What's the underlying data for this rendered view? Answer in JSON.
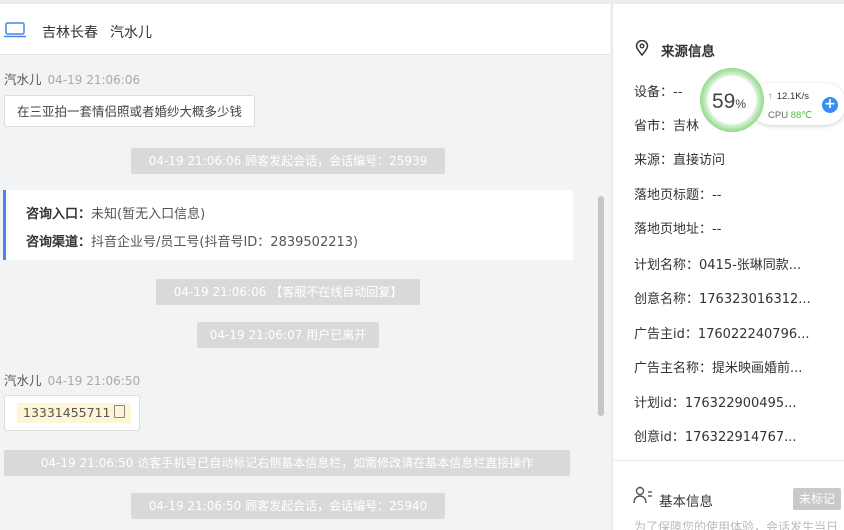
{
  "header": {
    "location": "吉林长春",
    "customer_name": "汽水儿"
  },
  "messages": {
    "msg1": {
      "sender": "汽水儿",
      "time": "04-19 21:06:06",
      "text": "在三亚拍一套情侣照或者婚纱大概多少钱"
    },
    "sys1": "04-19 21:06:06 顾客发起会话，会话编号：25939",
    "consult": {
      "entry_label": "咨询入口：",
      "entry_value": "未知(暂无入口信息)",
      "channel_label": "咨询渠道：",
      "channel_value": "抖音企业号/员工号(抖音号ID：2839502213)"
    },
    "sys2": "04-19 21:06:06 【客服不在线自动回复】",
    "sys3": "04-19 21:06:07 用户已离开",
    "msg2": {
      "sender": "汽水儿",
      "time": "04-19 21:06:50",
      "phone": "13331455711"
    },
    "sys4": "04-19 21:06:50 访客手机号已自动标记右侧基本信息栏，如需修改请在基本信息栏直接操作",
    "sys5": "04-19 21:06:50 顾客发起会话，会话编号：25940"
  },
  "source_panel": {
    "title": "来源信息",
    "rows": [
      "设备：--",
      "省市：吉林",
      "来源：直接访问",
      "落地页标题：--",
      "落地页地址：--",
      "计划名称：0415-张琳同款...",
      "创意名称：176323016312...",
      "广告主id：176022240796...",
      "广告主名称：提米映画婚前...",
      "计划id：176322900495...",
      "创意id：176322914767..."
    ],
    "basic_title": "基本信息",
    "tag": "未标记",
    "privacy_note": "为了保障您的使用体验，会话发生当日"
  },
  "monitor": {
    "percent": "59",
    "percent_unit": "%",
    "net_speed": "12.1K/s",
    "cpu_label": "CPU",
    "cpu_temp": "88℃"
  },
  "colors": {
    "accent": "#4a86e8",
    "system_msg_bg": "#d9d9d9",
    "phone_highlight": "#fdf5d6",
    "monitor_green": "#6fcd6a"
  },
  "icons": [
    "laptop-icon",
    "copy-icon",
    "location-pin-icon",
    "user-list-icon",
    "upload-arrow-icon",
    "plus-icon"
  ]
}
